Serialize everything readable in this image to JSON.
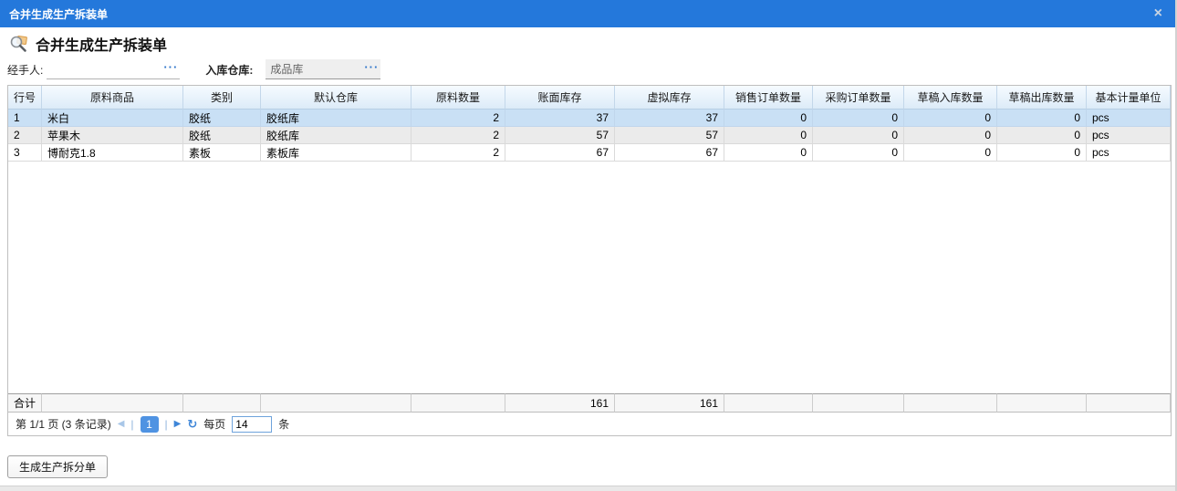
{
  "dialog": {
    "title": "合并生成生产拆装单",
    "close_icon": "×"
  },
  "header": {
    "title": "合并生成生产拆装单"
  },
  "form": {
    "handler_label": "经手人:",
    "handler_value": "",
    "handler_picker": "···",
    "warehouse_label": "入库仓库:",
    "warehouse_value": "成品库",
    "warehouse_picker": "···"
  },
  "table": {
    "columns": [
      "行号",
      "原料商品",
      "类别",
      "默认仓库",
      "原料数量",
      "账面库存",
      "虚拟库存",
      "销售订单数量",
      "采购订单数量",
      "草稿入库数量",
      "草稿出库数量",
      "基本计量单位"
    ],
    "rows": [
      [
        "1",
        "米白",
        "胶纸",
        "胶纸库",
        "2",
        "37",
        "37",
        "0",
        "0",
        "0",
        "0",
        "pcs"
      ],
      [
        "2",
        "苹果木",
        "胶纸",
        "胶纸库",
        "2",
        "57",
        "57",
        "0",
        "0",
        "0",
        "0",
        "pcs"
      ],
      [
        "3",
        "博耐克1.8",
        "素板",
        "素板库",
        "2",
        "67",
        "67",
        "0",
        "0",
        "0",
        "0",
        "pcs"
      ]
    ],
    "selected_row_index": 0,
    "totals": [
      "合计",
      "",
      "",
      "",
      "",
      "161",
      "161",
      "",
      "",
      "",
      "",
      ""
    ]
  },
  "pagination": {
    "summary": "第 1/1 页 (3 条记录)",
    "prev_icon": "◀",
    "separator": "|",
    "current_page": "1",
    "next_icon": "▶",
    "refresh_icon": "↻",
    "per_page_label": "每页",
    "per_page_value": "14",
    "per_page_unit": "条"
  },
  "footer": {
    "generate_button": "生成生产拆分单"
  },
  "colors": {
    "titlebar_blue": "#2478db",
    "selected_row": "#c9e0f5",
    "alt_row": "#ebebeb",
    "accent_blue": "#3e86d8",
    "page_box_blue": "#4f93e2",
    "picker_dots_blue": "#2e74c9"
  }
}
